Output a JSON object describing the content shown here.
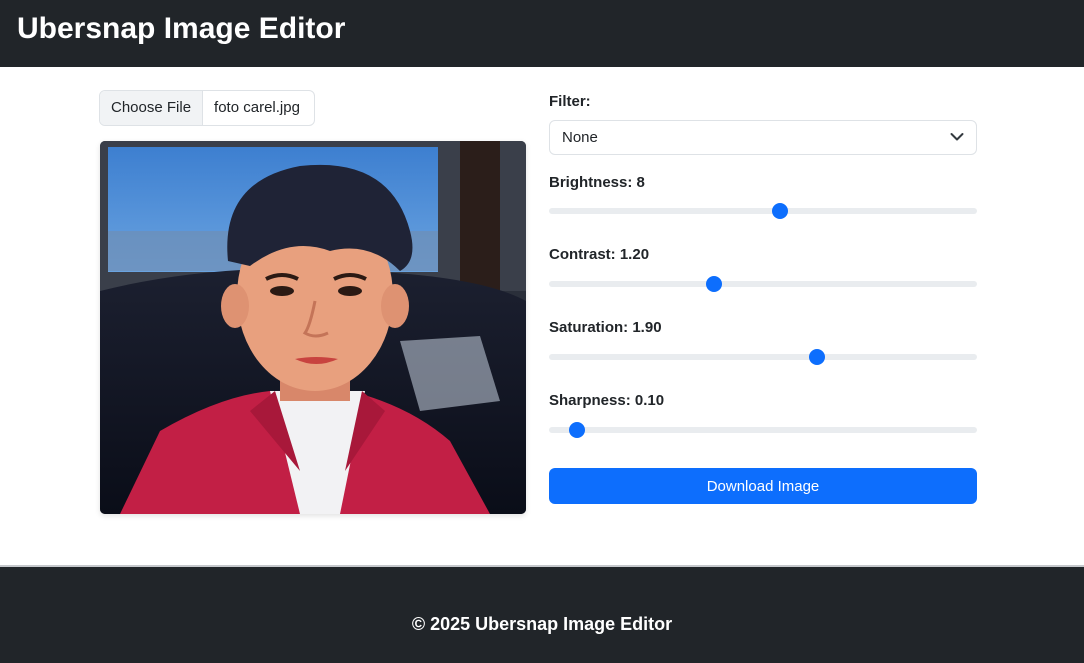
{
  "navbar": {
    "brand": "Ubersnap Image Editor"
  },
  "file_input": {
    "button_label": "Choose File",
    "file_name": "foto carel.jpg"
  },
  "preview": {
    "alt": "Uploaded photo preview"
  },
  "controls": {
    "filter": {
      "label": "Filter:",
      "selected": "None"
    },
    "brightness": {
      "label": "Brightness:",
      "value": "8",
      "level": 0.54
    },
    "contrast": {
      "label": "Contrast:",
      "value": "1.20",
      "level": 0.385
    },
    "saturation": {
      "label": "Saturation:",
      "value": "1.90",
      "level": 0.627
    },
    "sharpness": {
      "label": "Sharpness:",
      "value": "0.10",
      "level": 0.065
    }
  },
  "download_button": {
    "label": "Download Image"
  },
  "footer": {
    "text": "© 2025 Ubersnap Image Editor"
  },
  "colors": {
    "dark": "#212529",
    "accent": "#0d6efd",
    "track": "#e9ecef"
  }
}
